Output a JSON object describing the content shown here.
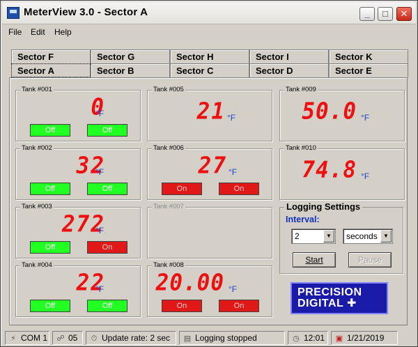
{
  "window": {
    "title": "MeterView 3.0 - Sector A"
  },
  "menu": [
    "File",
    "Edit",
    "Help"
  ],
  "tabs": {
    "back_row": [
      "Sector F",
      "Sector G",
      "Sector H",
      "Sector I",
      "Sector K"
    ],
    "front_row": [
      "Sector A",
      "Sector B",
      "Sector C",
      "Sector D",
      "Sector E"
    ],
    "active": "Sector A"
  },
  "tanks": [
    {
      "name": "Tank #001",
      "value": "0",
      "unit": "°F",
      "switches": [
        "Off",
        "Off"
      ]
    },
    {
      "name": "Tank #002",
      "value": "32",
      "unit": "°F",
      "switches": [
        "Off",
        "Off"
      ]
    },
    {
      "name": "Tank #003",
      "value": "272",
      "unit": "°F",
      "switches": [
        "Off",
        "On"
      ]
    },
    {
      "name": "Tank #004",
      "value": "22",
      "unit": "°F",
      "switches": [
        "Off",
        "Off"
      ]
    },
    {
      "name": "Tank #005",
      "value": "21",
      "unit": "°F"
    },
    {
      "name": "Tank #006",
      "value": "27",
      "unit": "°F",
      "switches": [
        "On",
        "On"
      ]
    },
    {
      "name": "Tank #007"
    },
    {
      "name": "Tank #008",
      "value": "20.00",
      "unit": "°F",
      "switches": [
        "On",
        "On"
      ]
    },
    {
      "name": "Tank #009",
      "value": "50.0",
      "unit": "°F"
    },
    {
      "name": "Tank #010",
      "value": "74.8",
      "unit": "°F"
    }
  ],
  "logging": {
    "title": "Logging Settings",
    "interval_label": "Interval:",
    "interval_value": "2",
    "interval_unit": "seconds",
    "start_label": "Start",
    "pause_label": "Pause"
  },
  "logo": {
    "line1": "PRECISION",
    "line2": "DIGITAL ✚"
  },
  "status": {
    "port": "COM 1",
    "address": "05",
    "update_rate": "Update rate: 2 sec",
    "logging": "Logging stopped",
    "time": "12:01",
    "date": "1/21/2019"
  },
  "colors": {
    "off": "#22ff22",
    "on": "#e01818",
    "readout": "#ee1010",
    "panel": "#d4d0c8"
  }
}
